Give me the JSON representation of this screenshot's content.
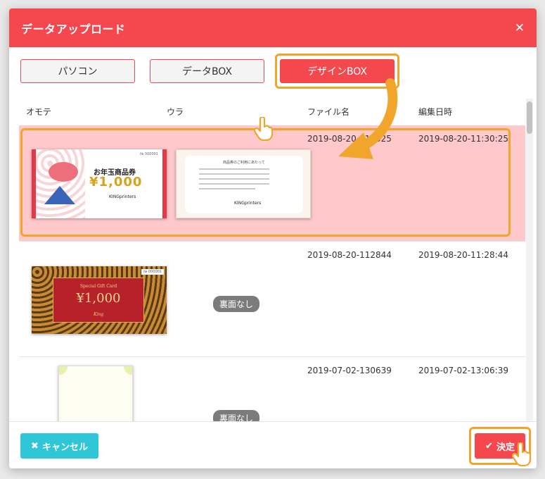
{
  "dialog": {
    "title": "データアップロード",
    "close": "✕"
  },
  "tabs": [
    {
      "label": "パソコン",
      "active": false
    },
    {
      "label": "データBOX",
      "active": false
    },
    {
      "label": "デザインBOX",
      "active": true
    }
  ],
  "table": {
    "headers": {
      "front": "オモテ",
      "back": "ウラ",
      "filename": "ファイル名",
      "edited": "編集日時"
    },
    "rows": [
      {
        "filename": "2019-08-20-113025",
        "edited": "2019-08-20-11:30:25",
        "selected": true,
        "front": {
          "title": "お年玉商品券",
          "amount": "¥1,000",
          "brand": "KINGprinters",
          "serial": "№ 000001"
        },
        "back": {
          "title": "商品券のご利用にあたって",
          "brand": "KINGprinters"
        }
      },
      {
        "filename": "2019-08-20-112844",
        "edited": "2019-08-20-11:28:44",
        "selected": false,
        "front": {
          "title": "Special Gift Card",
          "amount": "¥1,000",
          "brand": "King",
          "serial": "№ 000001"
        },
        "back_badge": "裏面なし"
      },
      {
        "filename": "2019-07-02-130639",
        "edited": "2019-07-02-13:06:39",
        "selected": false,
        "back_badge": "裏面なし"
      }
    ]
  },
  "footer": {
    "cancel_label": "キャンセル",
    "ok_label": "決定"
  },
  "colors": {
    "header": "#f5484e",
    "highlight": "#f1a52a",
    "cancel": "#2fc6d8",
    "selected_row": "#ffc9cb"
  },
  "icons": {
    "cancel": "times-icon",
    "ok": "check-icon",
    "cursor": "hand-pointer-icon"
  }
}
